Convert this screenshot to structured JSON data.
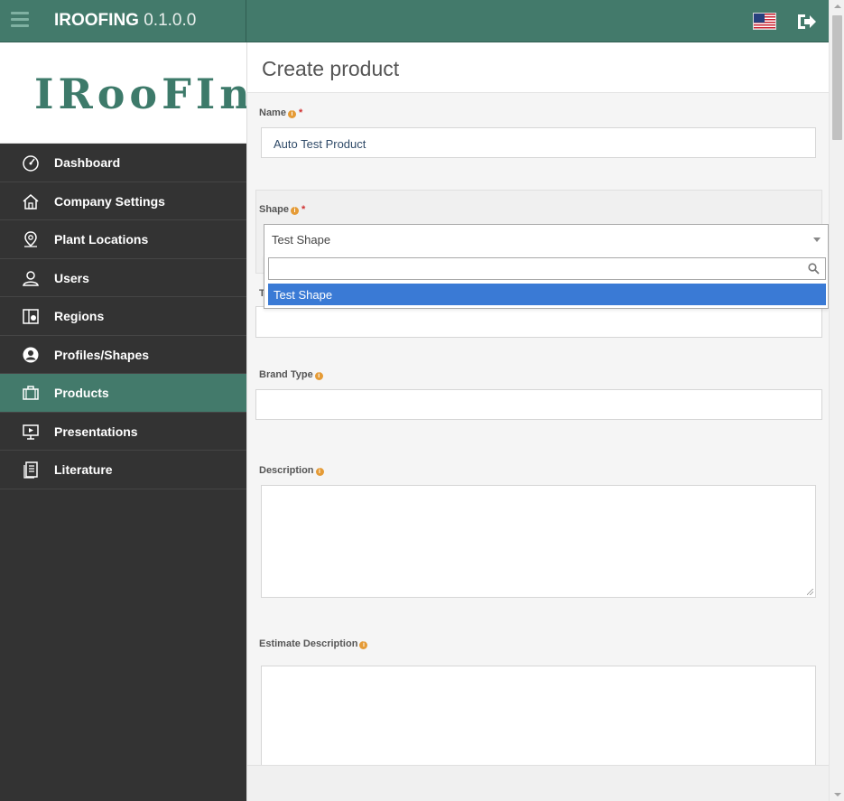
{
  "header": {
    "brand_name": "IROOFING",
    "version": "0.1.0.0",
    "language_flag": "us-flag-icon",
    "logout_icon": "logout-icon"
  },
  "sidebar": {
    "logo_text": "IRooFInG",
    "items": [
      {
        "label": "Dashboard",
        "icon": "dashboard-icon",
        "active": false
      },
      {
        "label": "Company Settings",
        "icon": "home-icon",
        "active": false
      },
      {
        "label": "Plant Locations",
        "icon": "location-pin-icon",
        "active": false
      },
      {
        "label": "Users",
        "icon": "user-icon",
        "active": false
      },
      {
        "label": "Regions",
        "icon": "map-icon",
        "active": false
      },
      {
        "label": "Profiles/Shapes",
        "icon": "profile-icon",
        "active": false
      },
      {
        "label": "Products",
        "icon": "briefcase-icon",
        "active": true
      },
      {
        "label": "Presentations",
        "icon": "presentation-icon",
        "active": false
      },
      {
        "label": "Literature",
        "icon": "literature-icon",
        "active": false
      }
    ]
  },
  "main": {
    "page_title": "Create product",
    "name": {
      "label": "Name",
      "required_marker": "*",
      "value": "Auto Test Product"
    },
    "shape": {
      "label": "Shape",
      "required_marker": "*",
      "selected": "Test Shape",
      "search_value": "",
      "options": [
        "Test Shape"
      ],
      "highlighted": "Test Shape"
    },
    "hidden_label_initial": "T",
    "brand_type": {
      "label": "Brand Type",
      "value": ""
    },
    "description": {
      "label": "Description",
      "value": ""
    },
    "estimate_description": {
      "label": "Estimate Description",
      "value": ""
    }
  },
  "colors": {
    "header_bg": "#437a6b",
    "sidebar_bg": "#333333",
    "active_item_bg": "#437a6b",
    "info_icon": "#e59b36",
    "required": "#d03030",
    "option_highlight": "#3a7ad5"
  }
}
